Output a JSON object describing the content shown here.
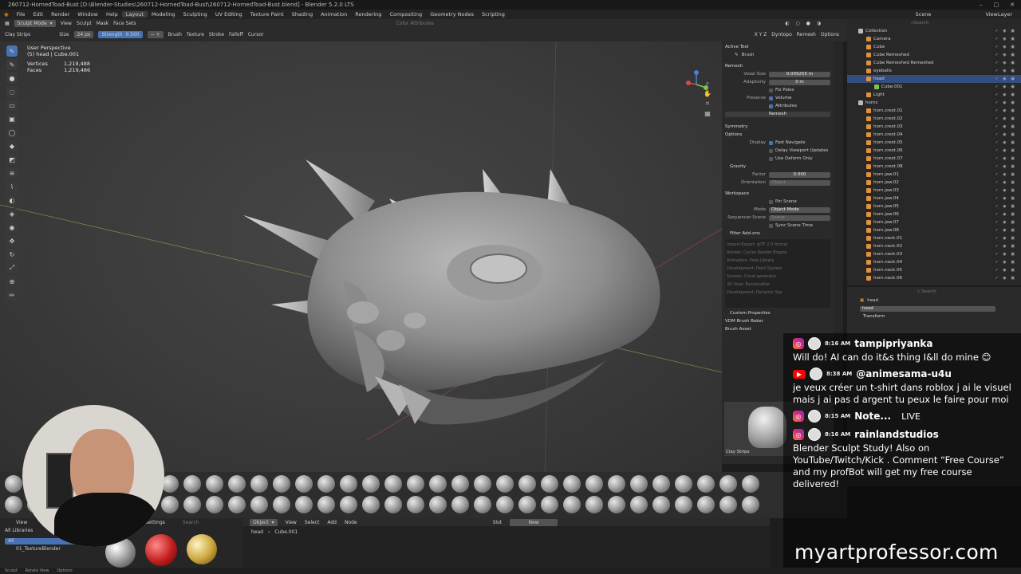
{
  "window": {
    "title": "260712-HornedToad-Bust [D:\\Blender-Studies\\260712-HornedToad-Bust\\260712-HornedToad-Bust.blend] - Blender 5.2.0 LTS"
  },
  "menus": [
    "File",
    "Edit",
    "Render",
    "Window",
    "Help"
  ],
  "workspaces": [
    "Layout",
    "Modeling",
    "Sculpting",
    "UV Editing",
    "Texture Paint",
    "Shading",
    "Animation",
    "Rendering",
    "Compositing",
    "Geometry Nodes",
    "Scripting"
  ],
  "active_workspace": "Layout",
  "scene": {
    "scene_label": "Scene",
    "view_layer": "ViewLayer"
  },
  "header": {
    "mode": "Sculpt Mode",
    "items": [
      "View",
      "Sculpt",
      "Mask",
      "Face Sets"
    ],
    "color_attr": "Color Attributes"
  },
  "toolsettings": {
    "brush": "Clay Strips",
    "size_label": "Size",
    "size": "24 px",
    "strength_label": "Strength",
    "strength": "0.500",
    "menus": [
      "Brush",
      "Texture",
      "Stroke",
      "Falloff",
      "Cursor"
    ],
    "right": [
      "Dyntopo",
      "Remesh",
      "Options"
    ]
  },
  "viewport": {
    "view": "User Perspective",
    "object": "(5) head | Cube.001",
    "verts_label": "Vertices",
    "verts": "1,219,488",
    "faces_label": "Faces",
    "faces": "1,219,486"
  },
  "npanel": {
    "active_tool": "Active Tool",
    "brush": "Brush",
    "remesh": "Remesh",
    "voxel_label": "Voxel Size",
    "voxel": "0.009255 m",
    "adapt_label": "Adaptivity",
    "adapt": "0 m",
    "fix_poles": "Fix Poles",
    "preserve_label": "Preserve",
    "volume": "Volume",
    "attributes": "Attributes",
    "remesh_btn": "Remesh",
    "symmetry": "Symmetry",
    "options": "Options",
    "display_label": "Display",
    "fast_nav": "Fast Navigate",
    "delay_updates": "Delay Viewport Updates",
    "deform_only": "Use Deform Only",
    "gravity": "Gravity",
    "factor_label": "Factor",
    "factor": "0.000",
    "orient_label": "Orientation",
    "orient": "Object",
    "workspace": "Workspace",
    "pin_scene": "Pin Scene",
    "mode_label": "Mode",
    "mode": "Object Mode",
    "seq_label": "Sequencer Scene",
    "seq": "Scene",
    "sync_time": "Sync Scene Time",
    "filter_addons": "Filter Add-ons",
    "addons": [
      "Import-Export: glTF 2.0 format",
      "Render: Cycles Render Engine",
      "Animation: Pose Library",
      "Development: Paint System",
      "System: Cloud generator",
      "3D View: Excelscatter",
      "Development: Dynamic Sky"
    ],
    "custom_props": "Custom Properties",
    "vdm": "VDM Brush Baker",
    "brush_asset": "Brush Asset",
    "asset_name": "Clay Strips"
  },
  "outliner": {
    "search": "Search",
    "rows": [
      {
        "name": "Collection",
        "type": "w"
      },
      {
        "name": "Camera",
        "type": "o"
      },
      {
        "name": "Cube",
        "type": "o"
      },
      {
        "name": "Cube Remeshed",
        "type": "o"
      },
      {
        "name": "Cube Remeshed Remeshed",
        "type": "o"
      },
      {
        "name": "eyeballs",
        "type": "o"
      },
      {
        "name": "head",
        "type": "o",
        "sel": true
      },
      {
        "name": "Cube.001",
        "type": "g"
      },
      {
        "name": "Light",
        "type": "o"
      },
      {
        "name": "horns",
        "type": "w"
      },
      {
        "name": "horn.crest.01",
        "type": "o"
      },
      {
        "name": "horn.crest.02",
        "type": "o"
      },
      {
        "name": "horn.crest.03",
        "type": "o"
      },
      {
        "name": "horn.crest.04",
        "type": "o"
      },
      {
        "name": "horn.crest.05",
        "type": "o"
      },
      {
        "name": "horn.crest.06",
        "type": "o"
      },
      {
        "name": "horn.crest.07",
        "type": "o"
      },
      {
        "name": "horn.crest.08",
        "type": "o"
      },
      {
        "name": "horn.jaw.01",
        "type": "o"
      },
      {
        "name": "horn.jaw.02",
        "type": "o"
      },
      {
        "name": "horn.jaw.03",
        "type": "o"
      },
      {
        "name": "horn.jaw.04",
        "type": "o"
      },
      {
        "name": "horn.jaw.05",
        "type": "o"
      },
      {
        "name": "horn.jaw.06",
        "type": "o"
      },
      {
        "name": "horn.jaw.07",
        "type": "o"
      },
      {
        "name": "horn.jaw.08",
        "type": "o"
      },
      {
        "name": "horn.neck.01",
        "type": "o"
      },
      {
        "name": "horn.neck.02",
        "type": "o"
      },
      {
        "name": "horn.neck.03",
        "type": "o"
      },
      {
        "name": "horn.neck.04",
        "type": "o"
      },
      {
        "name": "horn.neck.05",
        "type": "o"
      },
      {
        "name": "horn.neck.06",
        "type": "o"
      }
    ]
  },
  "props": {
    "object": "head",
    "name": "head",
    "transform": "Transform"
  },
  "chat": [
    {
      "platform": "instagram",
      "time": "8:16 AM",
      "user": "tampipriyanka",
      "text": "Will do! AI can do it&s thing I&ll do mine 😊"
    },
    {
      "platform": "youtube",
      "time": "8:38 AM",
      "user": "@animesama-u4u",
      "text": "je veux créer un t-shirt dans roblox j ai le visuel mais j ai pas d argent tu peux le faire pour moi"
    },
    {
      "platform": "instagram",
      "time": "8:15 AM",
      "user": "Note...",
      "badge": "LIVE",
      "text": ""
    },
    {
      "platform": "instagram",
      "time": "8:16 AM",
      "user": "rainlandstudios",
      "text": "Blender Sculpt Study! Also on YouTube/Twitch/Kick . Comment “Free Course” and my profBot will get my free course delivered!"
    }
  ],
  "brand": "myartprofessor.com",
  "asset_browser": {
    "view": "View",
    "all_libs": "All Libraries",
    "all": "All",
    "lib": "01_TextureBlender",
    "settings": "Settings",
    "search": "Search"
  },
  "node_editor": {
    "view": "View",
    "object": "Object",
    "menus": [
      "View",
      "Select",
      "Add",
      "Node"
    ],
    "slot": "Slot",
    "new": "New",
    "breadcrumb_a": "head",
    "breadcrumb_b": "Cube.001"
  },
  "status": [
    "Sculpt",
    "Rotate View",
    "Options"
  ],
  "colors": {
    "accent": "#4772b3",
    "selected_row": "#334d80",
    "object_orange": "#e0913c",
    "mesh_green": "#7ec44d"
  }
}
